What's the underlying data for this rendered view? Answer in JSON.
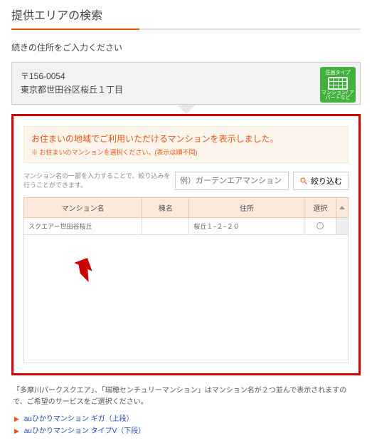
{
  "page_title": "提供エリアの検索",
  "subtitle": "続きの住所をご入力ください",
  "address": {
    "postal": "〒156-0054",
    "line": "東京都世田谷区桜丘１丁目"
  },
  "type_badge": {
    "top": "住居タイプ",
    "bottom": "マンション/\nアパートなど"
  },
  "message": {
    "main": "お住まいの地域でご利用いただけるマンションを表示しました。",
    "sub": "※ お住まいのマンションを選択ください。(表示は順不同)"
  },
  "filter": {
    "hint": "マンション名の一部を入力することで、絞り込みを行うことができます。",
    "placeholder": "例）ガーデンエアマンション",
    "button": "絞り込む"
  },
  "table": {
    "headers": {
      "name": "マンション名",
      "wing": "棟名",
      "addr": "住所",
      "select": "選択"
    },
    "rows": [
      {
        "name": "スクエアー世田谷桜丘",
        "wing": "",
        "addr": "桜丘１−２−２０"
      }
    ]
  },
  "footer": {
    "note": "「多摩川パークスクエア」、「瑞穂センチュリーマンション」はマンション名が２つ並んで表示されますので、ご希望のサービスをご選択ください。",
    "links": [
      "auひかりマンション ギガ（上段）",
      "auひかりマンション タイプV（下段）"
    ]
  }
}
